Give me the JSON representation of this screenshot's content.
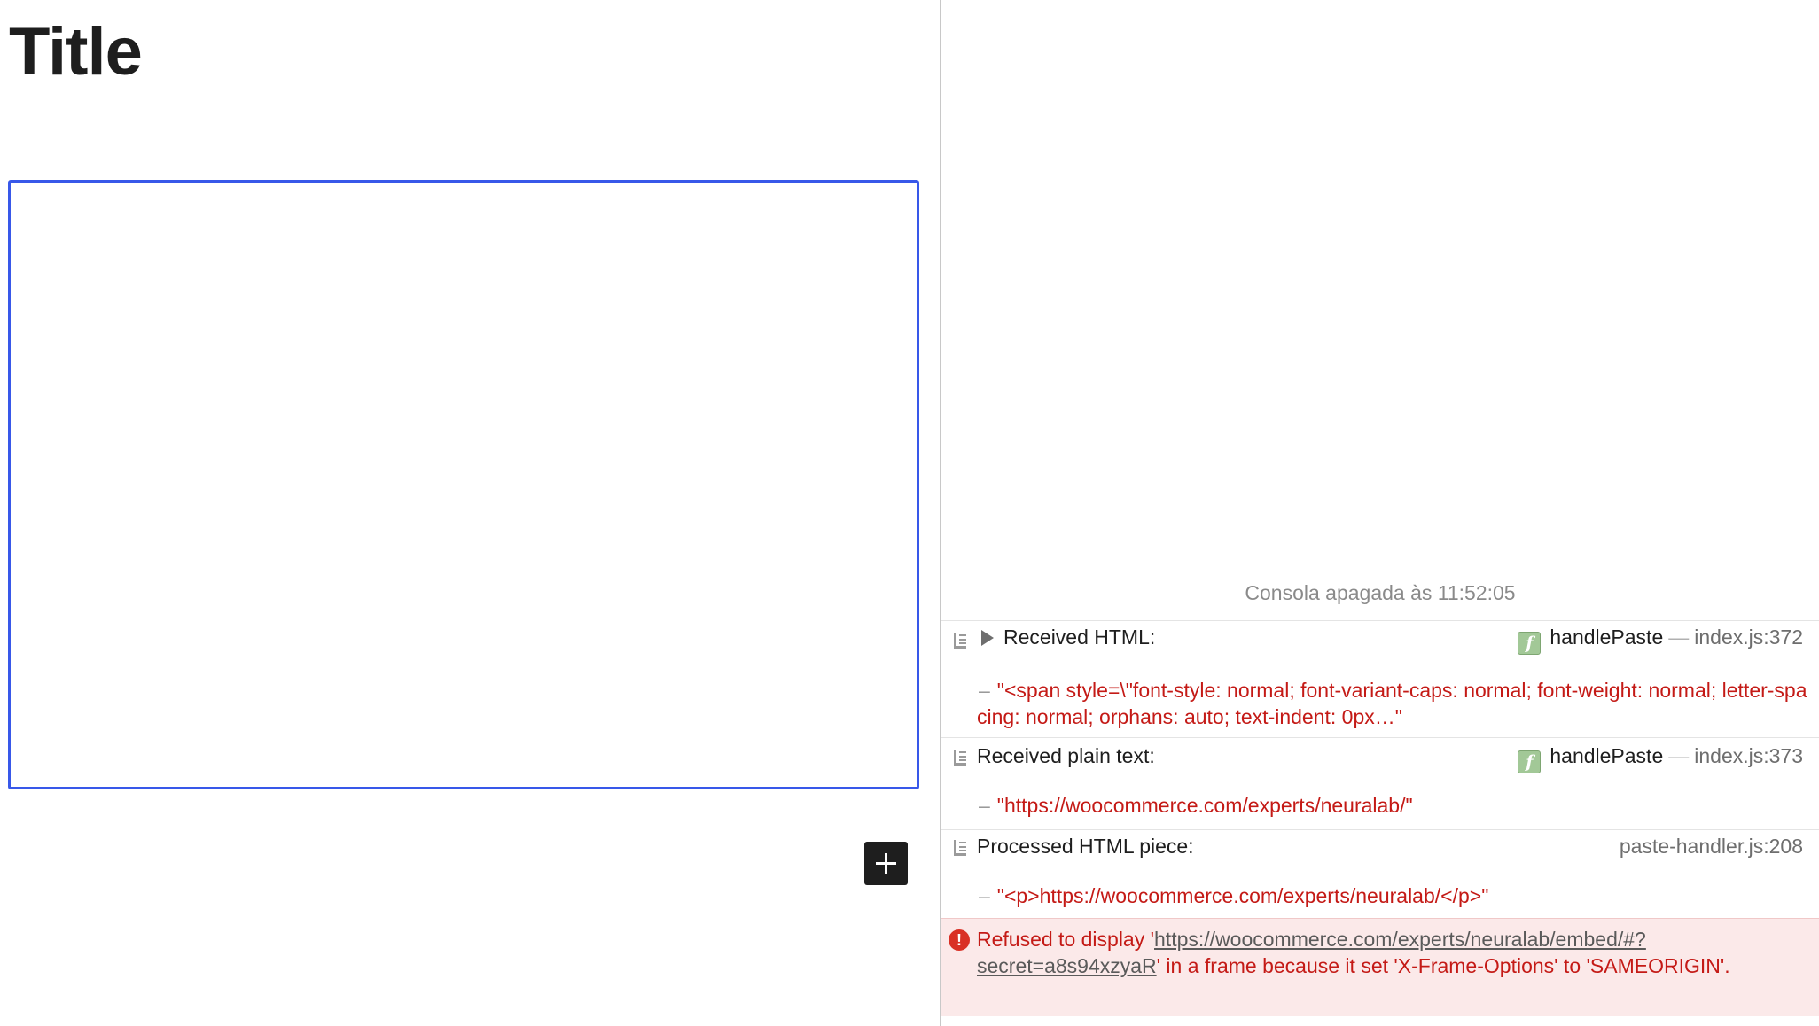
{
  "editor": {
    "title": "Title"
  },
  "console": {
    "cleared_message": "Consola apagada às 11:52:05",
    "entries": [
      {
        "message": "Received HTML:",
        "function": "handlePaste",
        "location": "index.js:372",
        "value": "\"<span style=\\\"font-style: normal; font-variant-caps: normal; font-weight: normal; letter-spacing: normal; orphans: auto; text-indent: 0px…\""
      },
      {
        "message": "Received plain text:",
        "function": "handlePaste",
        "location": "index.js:373",
        "value": "\"https://woocommerce.com/experts/neuralab/\""
      },
      {
        "message": "Processed HTML piece:",
        "location": "paste-handler.js:208",
        "value": "\"<p>https://woocommerce.com/experts/neuralab/</p>\""
      }
    ],
    "error": {
      "prefix": "Refused to display '",
      "url": "https://woocommerce.com/experts/neuralab/embed/#?secret=a8s94xzyaR",
      "suffix": "' in a frame because it set 'X-Frame-Options' to 'SAMEORIGIN'."
    },
    "value_dash": "–",
    "location_dash": "—",
    "fn_badge": "f",
    "error_badge": "!"
  },
  "icons": {
    "add": "plus-icon",
    "group": "console-group-icon",
    "disclosure": "disclosure-triangle-icon",
    "function": "function-icon",
    "error": "error-icon"
  },
  "colors": {
    "accent": "#3858e9",
    "string": "#c41a16",
    "error_bg": "#fbe9e9"
  }
}
